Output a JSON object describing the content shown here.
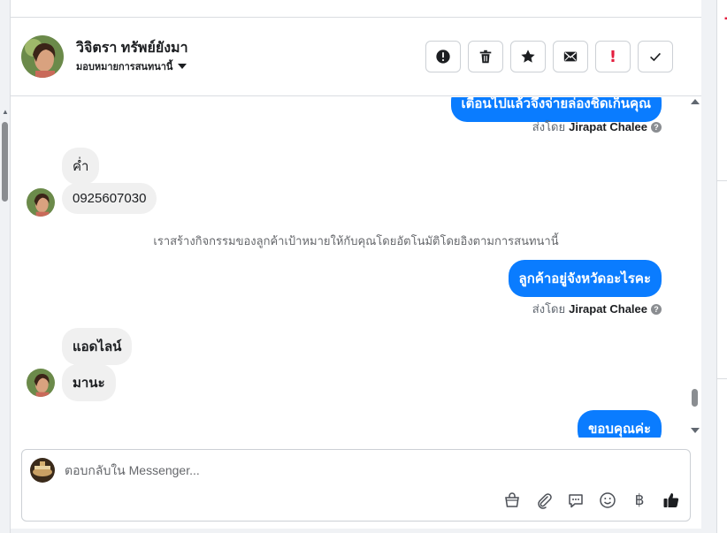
{
  "header": {
    "contact_name": "วิจิตรา ทรัพย์ยังมา",
    "assign_label": "มอบหมายการสนทนานี้"
  },
  "actions": [
    {
      "name": "report-icon"
    },
    {
      "name": "trash-icon"
    },
    {
      "name": "star-icon"
    },
    {
      "name": "envelope-icon"
    },
    {
      "name": "exclamation-icon"
    },
    {
      "name": "checkmark-icon"
    }
  ],
  "conversation": {
    "messages": {
      "out_top_partial": "เตือนไปแล้วจึงจ่ายล่องชิดเก็นคุณ",
      "sent_by_prefix": "ส่งโดย",
      "agent_name": "Jirapat Chalee",
      "in_1": "ค่ำ",
      "in_2": "0925607030",
      "system_note": "เราสร้างกิจกรรมของลูกค้าเป้าหมายให้กับคุณโดยอัตโนมัติโดยอิงตามการสนทนานี้",
      "out_2": "ลูกค้าอยู่จังหวัดอะไรคะ",
      "in_3": "แอดไลน์",
      "in_4": "มานะ",
      "out_3": "ขอบคุณค่ะ"
    }
  },
  "composer": {
    "placeholder": "ตอบกลับใน Messenger...",
    "tools": [
      "bag-icon",
      "paperclip-icon",
      "saved-reply-icon",
      "emoji-icon",
      "baht-icon",
      "thumbs-up-icon"
    ]
  },
  "colors": {
    "accent": "#0a7cff",
    "danger": "#e41e3f"
  }
}
